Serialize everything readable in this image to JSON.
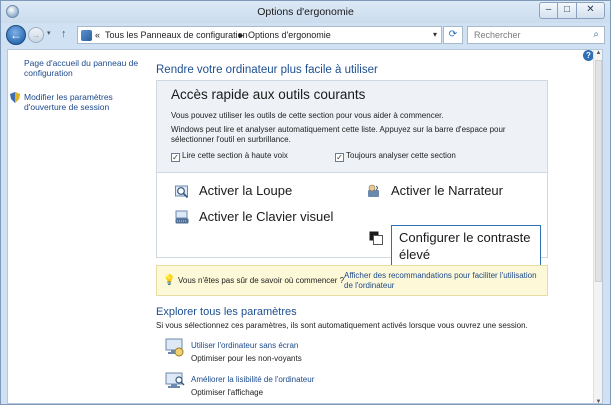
{
  "window": {
    "title": "Options d'ergonomie",
    "buttons": {
      "minimize": "–",
      "maximize": "□",
      "close": "✕"
    }
  },
  "nav": {
    "back_glyph": "←",
    "forward_glyph": "→",
    "history_glyph": "▾",
    "up_glyph": "↑",
    "breadcrumb_prefix": "«",
    "crumbs": [
      "Tous les Panneaux de configuration",
      "Options d'ergonomie"
    ],
    "crumb_separator": "▸",
    "address_dropdown": "▾",
    "refresh_glyph": "⟳",
    "search_placeholder": "Rechercher"
  },
  "sidebar": {
    "items": [
      {
        "label": "Page d'accueil du panneau de configuration"
      },
      {
        "label": "Modifier les paramètres d'ouverture de session"
      }
    ]
  },
  "main": {
    "help_glyph": "?",
    "heading": "Rendre votre ordinateur plus facile à utiliser",
    "quick_access": {
      "title": "Accès rapide aux outils courants",
      "intro": "Vous pouvez utiliser les outils de cette section pour vous aider à commencer.",
      "explain": "Windows peut lire et analyser automatiquement cette liste. Appuyez sur la barre d'espace pour sélectionner l'outil en surbrillance.",
      "checkbox_read": {
        "label": "Lire cette section à haute voix",
        "checked": true
      },
      "checkbox_scan": {
        "label": "Toujours analyser cette section",
        "checked": true
      },
      "check_glyph": "✓",
      "tools": {
        "magnifier": "Activer la Loupe",
        "narrator": "Activer le Narrateur",
        "keyboard": "Activer le Clavier visuel",
        "contrast": "Configurer le contraste élevé"
      }
    },
    "tip": {
      "glyph": "💡",
      "question": "Vous n'êtes pas sûr de savoir où commencer ?",
      "link": "Afficher des recommandations pour faciliter l'utilisation de l'ordinateur"
    },
    "explore": {
      "heading": "Explorer tous les paramètres",
      "description": "Si vous sélectionnez ces paramètres, ils sont automatiquement activés lorsque vous ouvrez une session.",
      "items": [
        {
          "link": "Utiliser l'ordinateur sans écran",
          "sub": "Optimiser pour les non-voyants"
        },
        {
          "link": "Améliorer la lisibilité de l'ordinateur",
          "sub": "Optimiser l'affichage"
        }
      ]
    }
  },
  "colors": {
    "link": "#1c4a8c",
    "heading": "#1d4f91",
    "focus_border": "#2f6fb5",
    "tip_background": "#fdf8d8"
  }
}
